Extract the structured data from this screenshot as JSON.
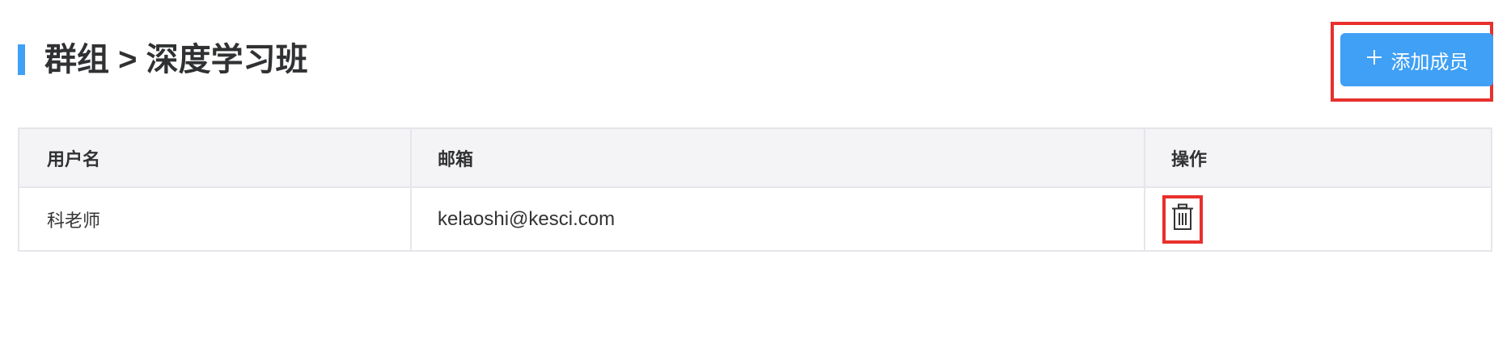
{
  "header": {
    "title": "群组 > 深度学习班"
  },
  "toolbar": {
    "add_member_label": "添加成员",
    "add_member_icon": "plus-icon"
  },
  "table": {
    "columns": [
      "用户名",
      "邮箱",
      "操作"
    ],
    "rows": [
      {
        "username": "科老师",
        "email": "kelaoshi@kesci.com",
        "action_icon": "trash-icon"
      }
    ]
  },
  "colors": {
    "accent": "#3fa0f5",
    "highlight": "#e8302c",
    "header_bg": "#f4f4f6",
    "border": "#e4e6ea"
  }
}
